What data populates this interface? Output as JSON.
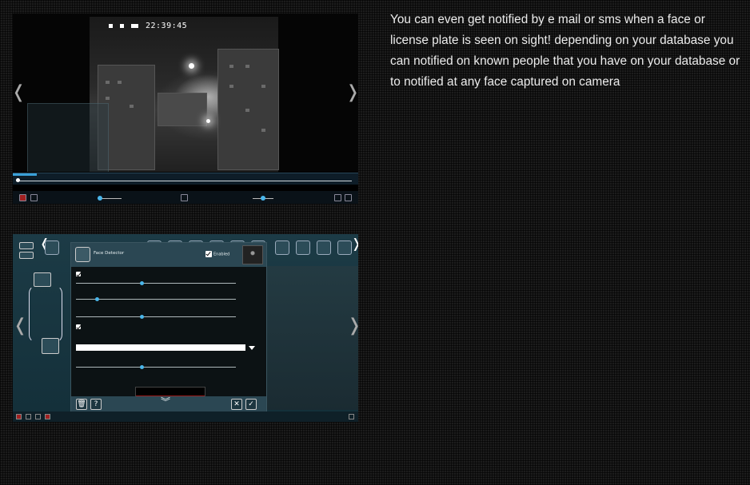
{
  "description": {
    "text": "You can even get notified by e mail or sms when a face or license plate is seen on sight! depending on your database you can notified on known people that you have on your database or to notified at any face captured on camera"
  },
  "video_screenshot": {
    "osd_time": "22:39:45",
    "prev_glyph": "❬",
    "next_glyph": "❭",
    "icons": [
      "record-icon",
      "snapshot-icon",
      "pause-icon",
      "fullscreen-icon"
    ]
  },
  "face_screenshot": {
    "dialog_title": "Face Detector",
    "enabled_label": "Enabled",
    "prev_glyph": "❬",
    "next_glyph": "❭",
    "icons": [
      "face-icon",
      "trash-icon",
      "help-icon",
      "cancel-icon",
      "ok-icon",
      "chevron-down-icon"
    ],
    "footer": {
      "trash_glyph": "🗑",
      "help_glyph": "?",
      "cancel_glyph": "✕",
      "ok_glyph": "✓",
      "chevron_glyph": "︾"
    }
  },
  "colors": {
    "accent": "#4ab6ea",
    "panel": "#2b4753",
    "alert": "#9c1b1b"
  }
}
